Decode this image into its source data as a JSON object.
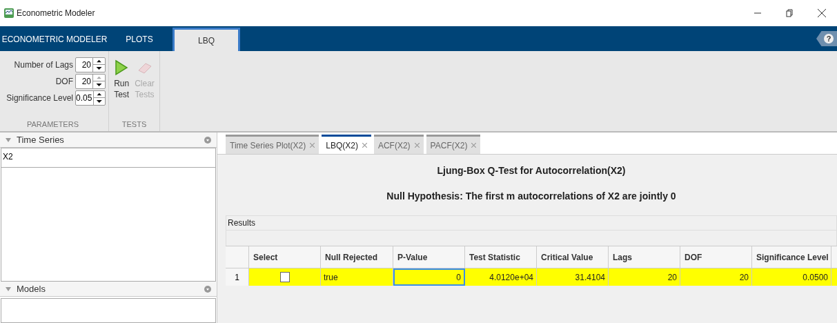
{
  "window": {
    "title": "Econometric Modeler"
  },
  "ribbon_tabs": [
    {
      "label": "ECONOMETRIC MODELER",
      "selected": false
    },
    {
      "label": "PLOTS",
      "selected": false
    },
    {
      "label": "LBQ",
      "selected": true
    }
  ],
  "help_button": {
    "label": "?"
  },
  "parameters": {
    "section": "PARAMETERS",
    "fields": [
      {
        "label": "Number of Lags",
        "value": "20",
        "up_disabled": false
      },
      {
        "label": "DOF",
        "value": "20",
        "up_disabled": true
      },
      {
        "label": "Significance Level",
        "value": "0.05",
        "up_disabled": false
      }
    ]
  },
  "tests": {
    "section": "TESTS",
    "buttons": [
      {
        "kind": "run",
        "label": [
          "Run",
          "Test"
        ],
        "disabled": false
      },
      {
        "kind": "clear",
        "label": [
          "Clear",
          "Tests"
        ],
        "disabled": true
      }
    ]
  },
  "time_series_panel": {
    "title": "Time Series",
    "items": [
      {
        "label": "X2",
        "selected": false
      }
    ]
  },
  "models_panel": {
    "title": "Models"
  },
  "doc_tabs": [
    {
      "label": "Time Series Plot(X2)",
      "selected": false
    },
    {
      "label": "LBQ(X2)",
      "selected": true
    },
    {
      "label": "ACF(X2)",
      "selected": false
    },
    {
      "label": "PACF(X2)",
      "selected": false
    }
  ],
  "report": {
    "title": "Ljung-Box Q-Test for Autocorrelation(X2)",
    "subtitle": "Null Hypothesis: The first m autocorrelations of X2 are jointly 0"
  },
  "results": {
    "title": "Results",
    "columns": [
      "Select",
      "Null Rejected",
      "P-Value",
      "Test Statistic",
      "Critical Value",
      "Lags",
      "DOF",
      "Significance Level"
    ],
    "rows": [
      {
        "index": "1",
        "checked": false,
        "null_rejected": "true",
        "p_value": "0",
        "test_statistic": "4.0120e+04",
        "critical_value": "31.4104",
        "lags": "20",
        "dof": "20",
        "significance_level": "0.0500",
        "highlighted": true
      }
    ]
  }
}
